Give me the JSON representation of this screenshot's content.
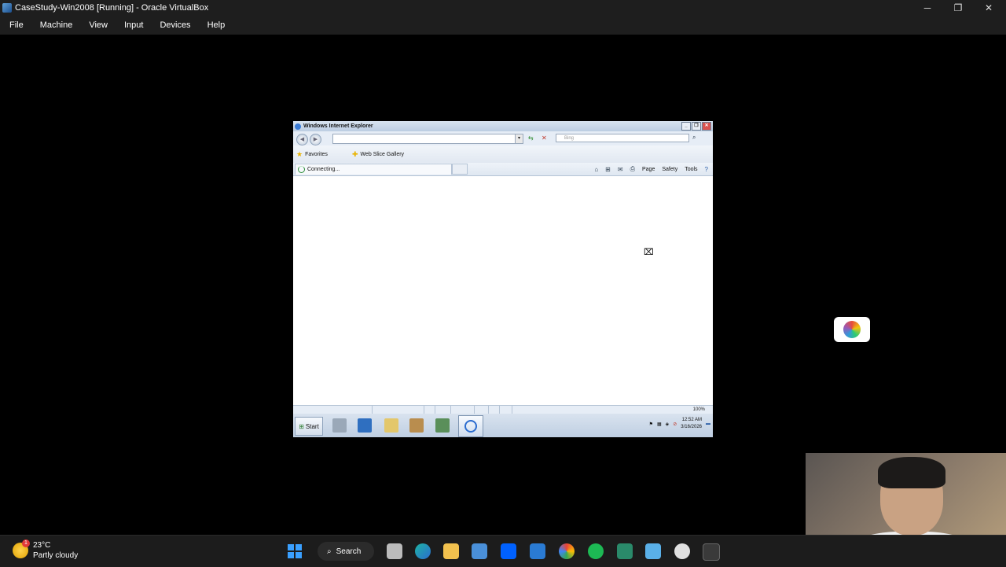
{
  "host_window": {
    "title": "CaseStudy-Win2008 [Running] - Oracle VirtualBox",
    "menu": [
      "File",
      "Machine",
      "View",
      "Input",
      "Devices",
      "Help"
    ],
    "controls": {
      "minimize": "─",
      "restore": "❐",
      "close": "✕"
    }
  },
  "ie": {
    "title": "Windows Internet Explorer",
    "search_placeholder": "Bing",
    "favorites_label": "Favorites",
    "web_slice_gallery": "Web Slice Gallery",
    "tab_label": "Connecting...",
    "commands": {
      "page": "Page",
      "safety": "Safety",
      "tools": "Tools"
    },
    "zoom": "100%"
  },
  "guest_taskbar": {
    "start_label": "Start",
    "time": "12:52 AM",
    "date": "3/16/2026"
  },
  "host_taskbar": {
    "weather_temp": "23°C",
    "weather_desc": "Partly cloudy",
    "weather_badge": "1",
    "search_label": "Search"
  },
  "colors": {
    "host_bg": "#1e1e1e",
    "accent": "#3aa0ff"
  }
}
